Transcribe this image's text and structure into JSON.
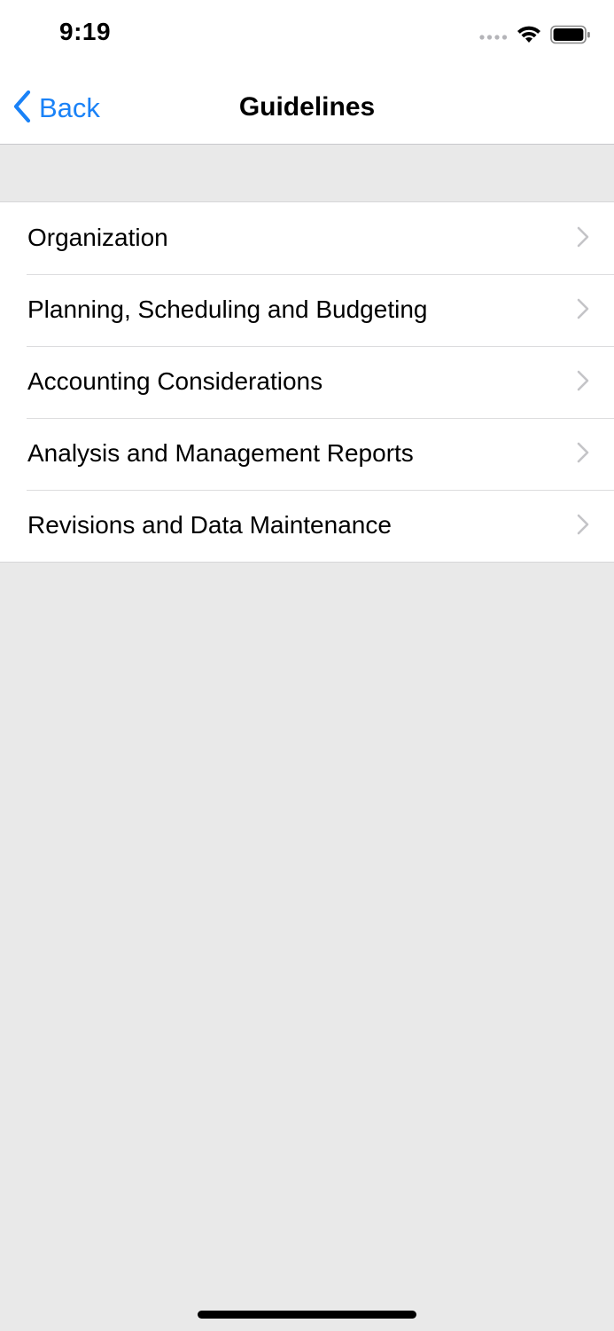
{
  "status_bar": {
    "time": "9:19",
    "icons": [
      "signal-dots-icon",
      "wifi-icon",
      "battery-icon"
    ]
  },
  "nav": {
    "back_label": "Back",
    "title": "Guidelines",
    "back_icon": "chevron-left-icon"
  },
  "list": {
    "items": [
      {
        "label": "Organization"
      },
      {
        "label": "Planning, Scheduling and Budgeting"
      },
      {
        "label": "Accounting Considerations"
      },
      {
        "label": "Analysis and Management Reports"
      },
      {
        "label": "Revisions and Data Maintenance"
      }
    ],
    "row_icon": "chevron-right-icon"
  },
  "colors": {
    "accent": "#1a82f7",
    "background": "#e9e9e9",
    "surface": "#ffffff",
    "chevron": "#c4c4c7"
  }
}
